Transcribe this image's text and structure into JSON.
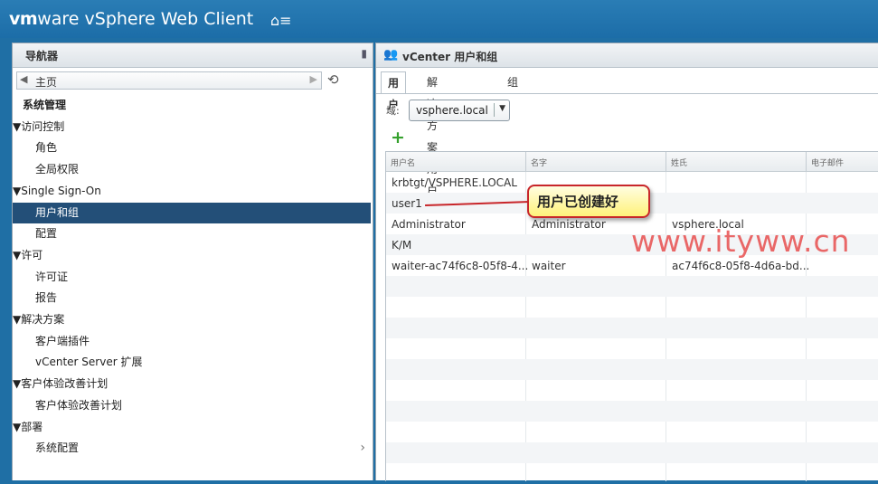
{
  "header": {
    "brand_vm": "vm",
    "brand_ware": "ware",
    "brand_rest": " vSphere Web Client",
    "home_icon": "home-menu-icon"
  },
  "navigator": {
    "title": "导航器",
    "breadcrumb": "主页",
    "tree": [
      {
        "label": "系统管理",
        "kind": "root"
      },
      {
        "label": "访问控制",
        "kind": "section"
      },
      {
        "label": "角色",
        "kind": "leaf"
      },
      {
        "label": "全局权限",
        "kind": "leaf"
      },
      {
        "label": "Single Sign-On",
        "kind": "section"
      },
      {
        "label": "用户和组",
        "kind": "leaf",
        "selected": true
      },
      {
        "label": "配置",
        "kind": "leaf"
      },
      {
        "label": "许可",
        "kind": "section"
      },
      {
        "label": "许可证",
        "kind": "leaf"
      },
      {
        "label": "报告",
        "kind": "leaf"
      },
      {
        "label": "解决方案",
        "kind": "section"
      },
      {
        "label": "客户端插件",
        "kind": "leaf"
      },
      {
        "label": "vCenter Server 扩展",
        "kind": "leaf"
      },
      {
        "label": "客户体验改善计划",
        "kind": "section"
      },
      {
        "label": "客户体验改善计划",
        "kind": "leaf"
      },
      {
        "label": "部署",
        "kind": "section"
      },
      {
        "label": "系统配置",
        "kind": "leaf"
      }
    ]
  },
  "main": {
    "title": "vCenter 用户和组",
    "tabs": [
      "用户",
      "解决方案用户",
      "组"
    ],
    "domain_label": "域:",
    "domain_value": "vsphere.local",
    "columns": [
      "用户名",
      "名字",
      "姓氏",
      "电子邮件"
    ],
    "rows": [
      [
        "krbtgt/VSPHERE.LOCAL",
        "",
        "",
        ""
      ],
      [
        "user1",
        "",
        "",
        ""
      ],
      [
        "Administrator",
        "Administrator",
        "vsphere.local",
        ""
      ],
      [
        "K/M",
        "",
        "",
        ""
      ],
      [
        "waiter-ac74f6c8-05f8-4...",
        "waiter",
        "ac74f6c8-05f8-4d6a-bd...",
        ""
      ]
    ]
  },
  "annotation": {
    "callout": "用户已创建好",
    "watermark": "www.ityww.cn",
    "color": "#c8262a"
  }
}
